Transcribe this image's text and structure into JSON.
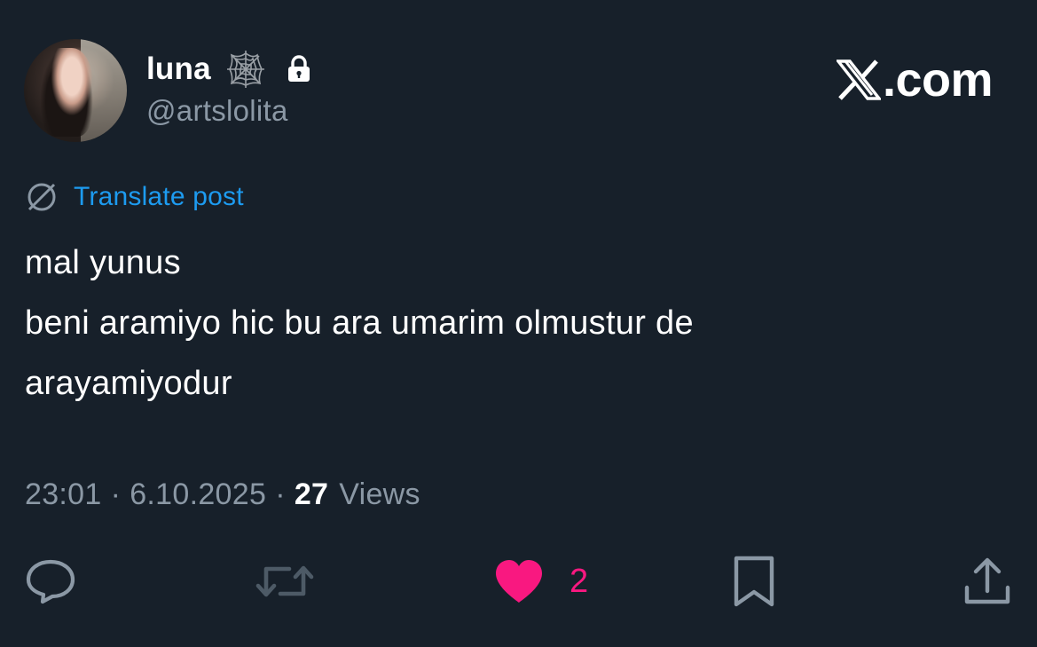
{
  "author": {
    "display_name": "luna",
    "handle": "@artslolita",
    "badges": [
      "spider-web-icon",
      "lock-icon"
    ]
  },
  "brand": {
    "text": ".com",
    "logo": "x-logo-icon"
  },
  "translate": {
    "label": "Translate post",
    "icon": "globe-icon",
    "color": "#1d9bf0"
  },
  "post": {
    "lines": [
      "mal yunus",
      "beni aramiyo hic bu ara umarim olmustur de",
      "arayamiyodur"
    ]
  },
  "meta": {
    "time": "23:01",
    "separator": "·",
    "date": "6.10.2025",
    "views_count": "27",
    "views_label": "Views"
  },
  "actions": {
    "reply": {
      "icon": "reply-icon"
    },
    "repost": {
      "icon": "repost-icon"
    },
    "like": {
      "icon": "heart-icon",
      "count": "2",
      "color": "#f91880",
      "liked": true
    },
    "bookmark": {
      "icon": "bookmark-icon"
    },
    "share": {
      "icon": "share-icon"
    }
  },
  "colors": {
    "background": "#17202a",
    "text": "#ffffff",
    "secondary": "#8b98a5",
    "accent": "#1d9bf0",
    "like": "#f91880"
  }
}
